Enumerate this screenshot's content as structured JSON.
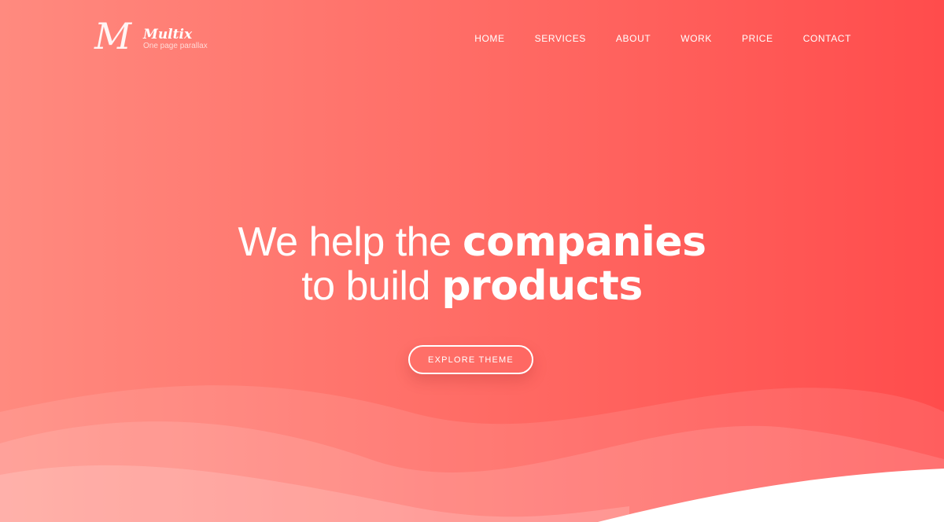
{
  "brand": {
    "logo_mark": "M",
    "name": "Multix",
    "tagline": "One page parallax"
  },
  "nav": {
    "items": [
      "HOME",
      "SERVICES",
      "ABOUT",
      "WORK",
      "PRICE",
      "CONTACT"
    ]
  },
  "hero": {
    "line1_light": "We help the",
    "line1_bold": "companies",
    "line2_light": "to build",
    "line2_bold": "products"
  },
  "cta": {
    "label": "EXPLORE THEME"
  },
  "colors": {
    "gradient_start": "#ff8a7f",
    "gradient_end": "#ff4c4c",
    "text": "#ffffff"
  }
}
